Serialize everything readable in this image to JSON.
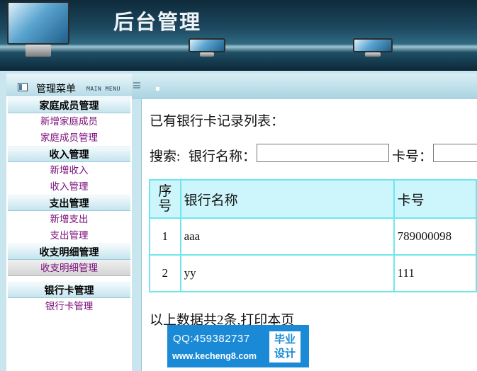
{
  "header": {
    "title": "后台管理"
  },
  "menu": {
    "title": "管理菜单",
    "title_en": "MAIN MENU",
    "categories": [
      {
        "label": "家庭成员管理",
        "items": [
          "新增家庭成员",
          "家庭成员管理"
        ]
      },
      {
        "label": "收入管理",
        "items": [
          "新增收入",
          "收入管理"
        ]
      },
      {
        "label": "支出管理",
        "items": [
          "新增支出",
          "支出管理"
        ]
      },
      {
        "label": "收支明细管理",
        "items": [
          "收支明细管理"
        ]
      },
      {
        "label": "银行卡管理",
        "items": [
          "银行卡管理"
        ]
      }
    ]
  },
  "main": {
    "list_title": "已有银行卡记录列表：",
    "search": {
      "label": "搜索:",
      "bank_label": "银行名称：",
      "bank_value": "",
      "card_label": "卡号：",
      "card_value": ""
    },
    "table": {
      "headers": [
        "序号",
        "银行名称",
        "卡号"
      ],
      "rows": [
        [
          "1",
          "aaa",
          "789000098"
        ],
        [
          "2",
          "yy",
          "111"
        ]
      ]
    },
    "footer": "以上数据共2条,打印本页"
  },
  "ad": {
    "qq": "QQ:459382737",
    "url": "www.kecheng8.com",
    "badge_line1": "毕业",
    "badge_line2": "设计"
  },
  "colors": {
    "table_border": "#6fe6ee",
    "table_header_bg": "#ccf6fb",
    "menu_link": "#7a0b7a",
    "ad_bg": "#1a8ad6"
  }
}
